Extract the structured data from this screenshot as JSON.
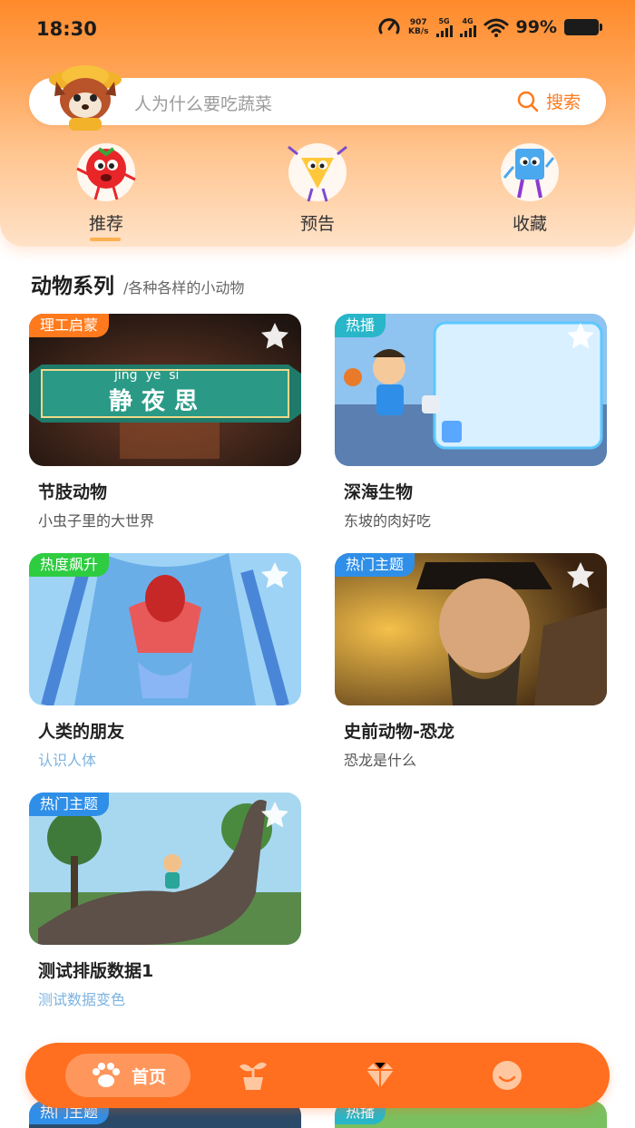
{
  "status_bar": {
    "time": "18:30",
    "net_speed_value": "907",
    "net_speed_unit": "KB/s",
    "sig1_label": "5G",
    "sig2_label": "4G",
    "battery": "99%"
  },
  "search": {
    "placeholder": "人为什么要吃蔬菜",
    "button_label": "搜索"
  },
  "categories": [
    {
      "label": "推荐",
      "icon": "tomato-mascot-icon"
    },
    {
      "label": "预告",
      "icon": "megaphone-mascot-icon"
    },
    {
      "label": "收藏",
      "icon": "box-mascot-icon"
    }
  ],
  "section": {
    "title": "动物系列",
    "subtitle": "/各种各样的小动物"
  },
  "cards": [
    {
      "badge": "理工启蒙",
      "badge_color": "#ff7a1c",
      "title": "节肢动物",
      "subtitle": "小虫子里的大世界",
      "banner_pinyin": "jing  ye  si",
      "banner_text": "静夜思"
    },
    {
      "badge": "热播",
      "badge_color": "#29b6c9",
      "title": "深海生物",
      "subtitle": "东坡的肉好吃"
    },
    {
      "badge": "热度飙升",
      "badge_color": "#2ecc40",
      "title": "人类的朋友",
      "subtitle": "认识人体"
    },
    {
      "badge": "热门主题",
      "badge_color": "#2f8fe8",
      "title": "史前动物-恐龙",
      "subtitle": "恐龙是什么"
    },
    {
      "badge": "热门主题",
      "badge_color": "#2f8fe8",
      "title": "测试排版数据1",
      "subtitle": "测试数据变色"
    }
  ],
  "peek_cards": [
    {
      "badge": "热门主题"
    },
    {
      "badge": "热播"
    }
  ],
  "bottom_nav": {
    "home_label": "首页",
    "items": [
      "paw-icon",
      "sprout-icon",
      "diamond-icon",
      "smile-icon"
    ]
  },
  "colors": {
    "accent": "#ff6f1f",
    "header_top": "#ff8a2a",
    "subtitle_blue": "#7cb3e0"
  }
}
